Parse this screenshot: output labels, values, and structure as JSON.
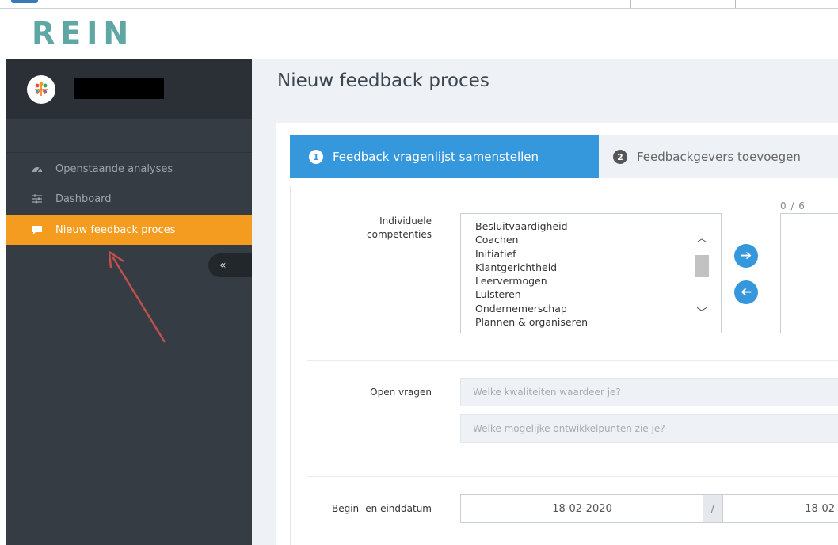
{
  "brand": {
    "logo_text": "REIN"
  },
  "sidebar": {
    "items": [
      {
        "label": "Openstaande analyses",
        "icon": "dashboard-gauge-icon",
        "active": false
      },
      {
        "label": "Dashboard",
        "icon": "sliders-icon",
        "active": false
      },
      {
        "label": "Nieuw feedback proces",
        "icon": "chat-bubble-icon",
        "active": true
      }
    ],
    "collapse_label": "«"
  },
  "page": {
    "title": "Nieuw feedback proces"
  },
  "wizard": {
    "steps": [
      {
        "number": "1",
        "label": "Feedback vragenlijst samenstellen",
        "active": true
      },
      {
        "number": "2",
        "label": "Feedbackgevers toevoegen",
        "active": false
      }
    ]
  },
  "competencies": {
    "label": "Individuele competenties",
    "options": [
      "Besluitvaardigheid",
      "Coachen",
      "Initiatief",
      "Klantgerichtheid",
      "Leervermogen",
      "Luisteren",
      "Ondernemerschap",
      "Plannen & organiseren"
    ],
    "selected_counter": "0 / 6"
  },
  "open_questions": {
    "label": "Open vragen",
    "placeholders": [
      "Welke kwaliteiten waardeer je?",
      "Welke mogelijke ontwikkelpunten zie je?"
    ]
  },
  "dates": {
    "label": "Begin- en einddatum",
    "start": "18-02-2020",
    "separator": "/",
    "end": "18-02"
  },
  "colors": {
    "accent_orange": "#f39c1f",
    "accent_blue": "#3598dc",
    "sidebar_bg": "#353c43",
    "annotation_arrow": "#c0504d"
  }
}
